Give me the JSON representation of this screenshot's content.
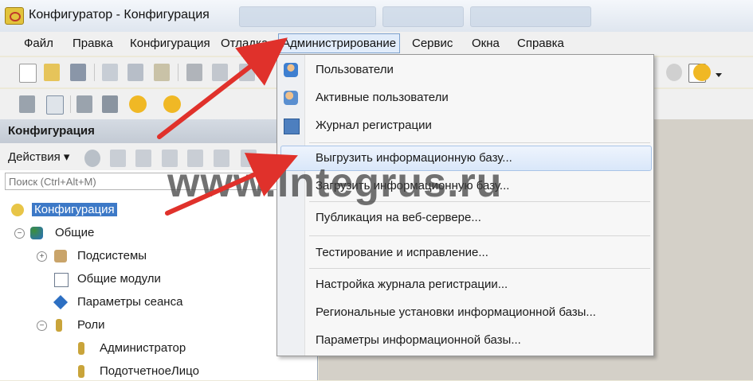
{
  "window": {
    "title": "Конфигуратор - Конфигурация"
  },
  "menubar": {
    "items": [
      "Файл",
      "Правка",
      "Конфигурация",
      "Отладка",
      "Администрирование",
      "Сервис",
      "Окна",
      "Справка"
    ],
    "active": "Администрирование"
  },
  "panel": {
    "title": "Конфигурация",
    "actions_label": "Действия",
    "search_placeholder": "Поиск (Ctrl+Alt+M)"
  },
  "tree": [
    {
      "label": "Конфигурация",
      "icon": "configuration-icon",
      "selected": true
    },
    {
      "label": "Общие",
      "icon": "common-icon",
      "expander": "minus"
    },
    {
      "label": "Подсистемы",
      "icon": "subsystems-icon",
      "expander": "plus"
    },
    {
      "label": "Общие модули",
      "icon": "module-icon"
    },
    {
      "label": "Параметры сеанса",
      "icon": "session-params-icon"
    },
    {
      "label": "Роли",
      "icon": "role-icon",
      "expander": "minus"
    },
    {
      "label": "Администратор",
      "icon": "role-icon"
    },
    {
      "label": "ПодотчетноеЛицо",
      "icon": "role-icon"
    }
  ],
  "dropdown": {
    "items": [
      {
        "label": "Пользователи",
        "icon": "users-icon"
      },
      {
        "label": "Активные пользователи",
        "icon": "active-users-icon"
      },
      {
        "label": "Журнал регистрации",
        "icon": "log-icon"
      },
      {
        "label": "Выгрузить информационную базу...",
        "highlighted": true
      },
      {
        "label": "Загрузить информационную базу..."
      },
      {
        "label": "Публикация на веб-сервере..."
      },
      {
        "label": "Тестирование и исправление..."
      },
      {
        "label": "Настройка журнала регистрации..."
      },
      {
        "label": "Региональные установки информационной базы..."
      },
      {
        "label": "Параметры информационной базы..."
      }
    ]
  },
  "watermark": "www.Integrus.ru",
  "colors": {
    "annotation_arrow": "#e0312b",
    "highlight": "#d9e7f9",
    "selection": "#3d79c7"
  }
}
